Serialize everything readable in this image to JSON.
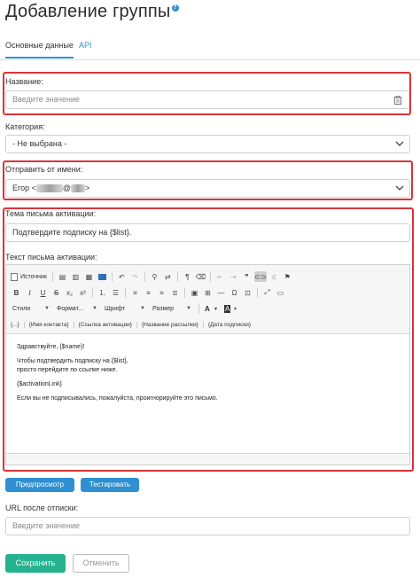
{
  "page": {
    "title": "Добавление группы",
    "help_icon": "?"
  },
  "tabs": [
    {
      "label": "Основные данные",
      "active": true
    },
    {
      "label": "API",
      "active": false
    }
  ],
  "fields": {
    "name": {
      "label": "Название:",
      "placeholder": "Введите значение"
    },
    "category": {
      "label": "Категория:",
      "value": "- Не выбрана -"
    },
    "sender": {
      "label": "Отправить от имени:",
      "value_prefix": "Егор <",
      "value_at": "@",
      "value_suffix": ">"
    },
    "activation_subject": {
      "label": "Тема письма активации:",
      "value": "Подтвердите подписку на {$list}."
    },
    "activation_text": {
      "label": "Текст письма активации:"
    },
    "unsubscribe_url": {
      "label": "URL после отписки:",
      "placeholder": "Введите значение"
    }
  },
  "editor": {
    "source_label": "Источник",
    "styles_label": "Стили",
    "format_label": "Формат...",
    "font_label": "Шрифт",
    "size_label": "Размер",
    "text_color": "A",
    "bg_color": "A",
    "links": [
      "{...}",
      "{Имя контакта}",
      "{Ссылка активации}",
      "{Название рассылки}",
      "{Дата подписки}"
    ],
    "body": [
      "Здравствуйте, {$name}!",
      "Чтобы подтвердить подписку на {$list},",
      "просто перейдите по ссылке ниже.",
      "{$activationLink}",
      "Если вы не подписывались, пожалуйста, проигнорируйте это письмо."
    ]
  },
  "buttons": {
    "preview": "Предпросмотр",
    "test": "Тестировать",
    "save": "Сохранить",
    "cancel": "Отменить"
  },
  "colors": {
    "accent": "#2e90d1",
    "save": "#26b28f",
    "highlight": "#d9333a"
  }
}
